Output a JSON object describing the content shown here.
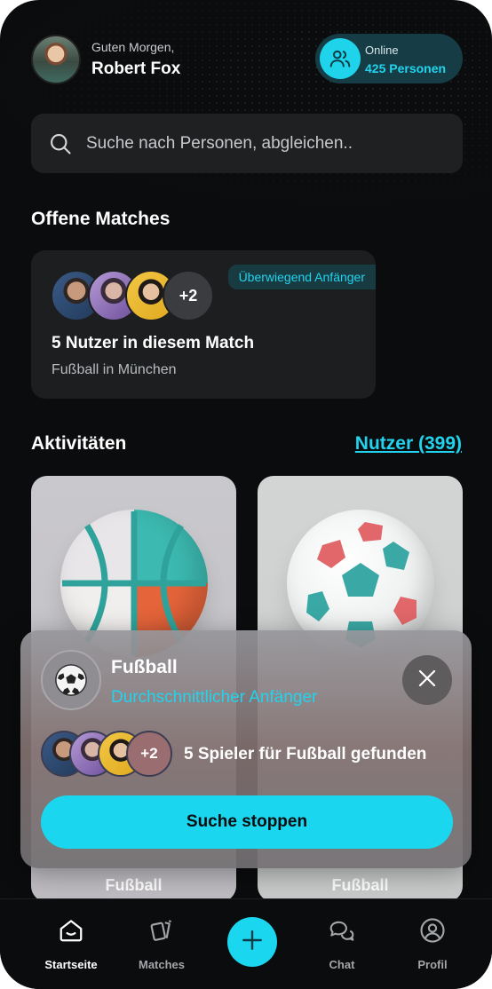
{
  "header": {
    "greeting": "Guten Morgen,",
    "user_name": "Robert Fox",
    "online_label": "Online",
    "online_count": "425 Personen"
  },
  "search": {
    "placeholder": "Suche nach Personen, abgleichen.."
  },
  "open_matches": {
    "title": "Offene Matches",
    "card": {
      "badge": "Überwiegend Anfänger",
      "more_count": "+2",
      "title": "5 Nutzer in diesem Match",
      "subtitle": "Fußball in München"
    }
  },
  "activities": {
    "title": "Aktivitäten",
    "users_link": "Nutzer (399)",
    "cards": [
      {
        "label": "Fußball",
        "ball": "basketball"
      },
      {
        "label": "Fußball",
        "ball": "soccer-ball"
      }
    ]
  },
  "search_overlay": {
    "title": "Fußball",
    "level": "Durchschnittlicher Anfänger",
    "more_count": "+2",
    "found_text": "5 Spieler für Fußball gefunden",
    "stop_button": "Suche stoppen"
  },
  "tabbar": {
    "items": [
      {
        "label": "Startseite",
        "icon": "home-icon",
        "active": true
      },
      {
        "label": "Matches",
        "icon": "cards-icon",
        "active": false
      },
      {
        "label": "Chat",
        "icon": "chat-icon",
        "active": false
      },
      {
        "label": "Profil",
        "icon": "profile-icon",
        "active": false
      }
    ]
  },
  "colors": {
    "accent": "#1ad6ef",
    "background": "#0b0c0d",
    "card": "#1c1e20"
  }
}
